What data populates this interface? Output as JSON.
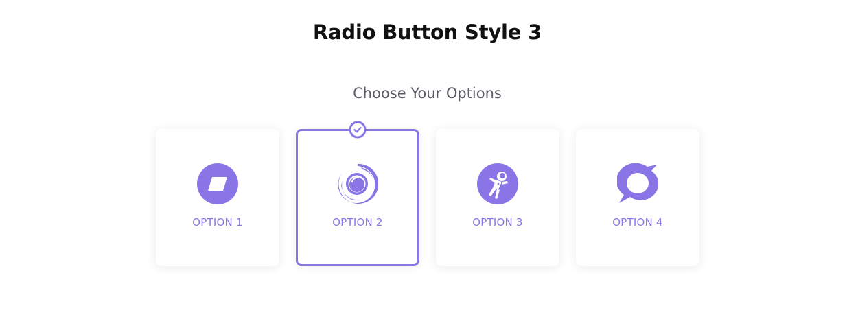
{
  "page": {
    "title": "Radio Button Style 3",
    "subtitle": "Choose Your Options"
  },
  "colors": {
    "accent": "#8a75e6",
    "title": "#111111",
    "subtitle": "#5c5c66",
    "card_bg": "#ffffff"
  },
  "options": [
    {
      "label": "OPTION 1",
      "icon": "parallelogram-icon",
      "selected": false
    },
    {
      "label": "OPTION 2",
      "icon": "orbit-icon",
      "selected": true
    },
    {
      "label": "OPTION 3",
      "icon": "astronaut-icon",
      "selected": false
    },
    {
      "label": "OPTION 4",
      "icon": "speech-bubble-icon",
      "selected": false
    }
  ],
  "selected_indicator_icon": "check-circle-icon"
}
